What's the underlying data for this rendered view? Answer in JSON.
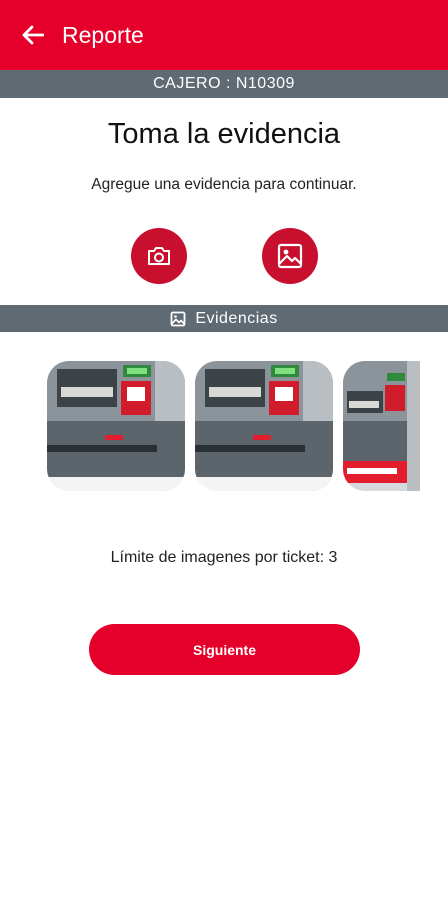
{
  "appbar": {
    "title": "Reporte",
    "back_icon": "arrow-left-icon"
  },
  "cajero_label": "CAJERO : N10309",
  "main": {
    "heading": "Toma la evidencia",
    "subtitle": "Agregue una evidencia para continuar.",
    "camera_icon": "camera-icon",
    "gallery_icon": "image-gallery-icon"
  },
  "evidencias": {
    "label": "Evidencias",
    "icon": "image-icon",
    "thumbnails": [
      {
        "name": "atm-photo-1"
      },
      {
        "name": "atm-photo-2"
      },
      {
        "name": "atm-photo-3"
      }
    ]
  },
  "limit_text": "Límite de imagenes por ticket: 3",
  "next_button": "Siguiente",
  "colors": {
    "accent": "#e4002b",
    "circle": "#c8102e",
    "band": "#5f6a73"
  }
}
